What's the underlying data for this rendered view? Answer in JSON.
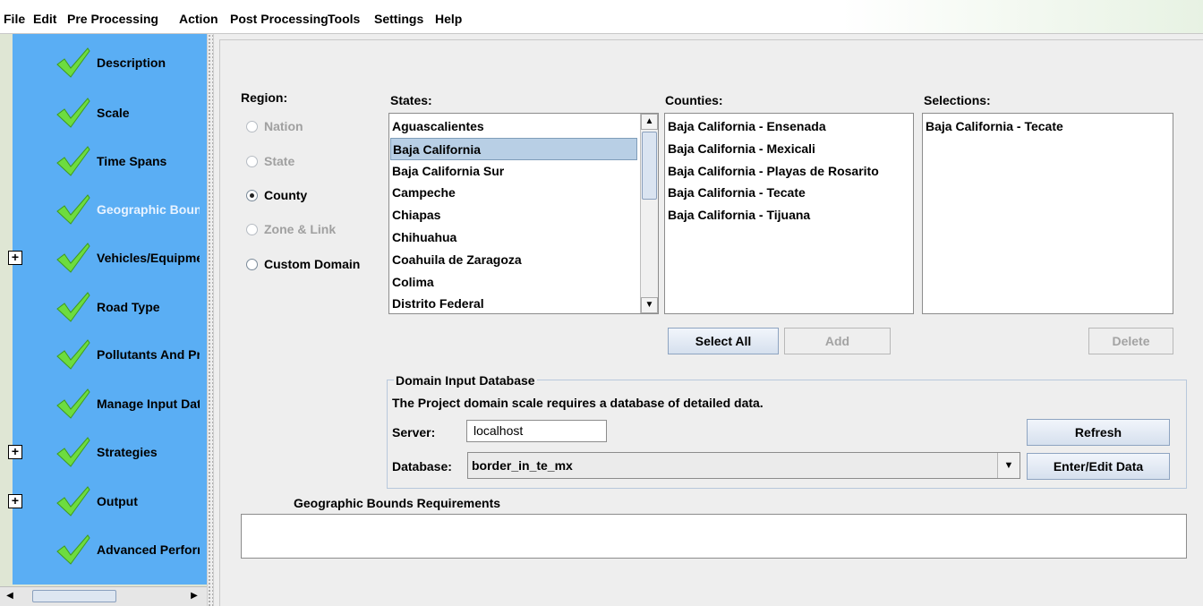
{
  "menu": [
    {
      "label": "File",
      "name": "menu-file"
    },
    {
      "label": "Edit",
      "name": "menu-edit"
    },
    {
      "label": "Pre Processing",
      "name": "menu-pre-processing"
    },
    {
      "label": "Action",
      "name": "menu-action"
    },
    {
      "label": "Post Processing",
      "name": "menu-post-processing"
    },
    {
      "label": "Tools",
      "name": "menu-tools"
    },
    {
      "label": "Settings",
      "name": "menu-settings"
    },
    {
      "label": "Help",
      "name": "menu-help"
    }
  ],
  "nav": {
    "items": [
      {
        "label": "Description",
        "expandable": false,
        "active": false
      },
      {
        "label": "Scale",
        "expandable": false,
        "active": false
      },
      {
        "label": "Time Spans",
        "expandable": false,
        "active": false
      },
      {
        "label": "Geographic Bounds",
        "expandable": false,
        "active": true
      },
      {
        "label": "Vehicles/Equipment",
        "expandable": true,
        "active": false
      },
      {
        "label": "Road Type",
        "expandable": false,
        "active": false
      },
      {
        "label": "Pollutants And Processes",
        "expandable": false,
        "active": false
      },
      {
        "label": "Manage Input Data Sets",
        "expandable": false,
        "active": false
      },
      {
        "label": "Strategies",
        "expandable": true,
        "active": false
      },
      {
        "label": "Output",
        "expandable": true,
        "active": false
      },
      {
        "label": "Advanced Performance Features",
        "expandable": false,
        "active": false
      }
    ],
    "expand_glyph": "+",
    "check_color": "#6ddc3f"
  },
  "region": {
    "label": "Region:",
    "options": [
      {
        "label": "Nation",
        "selected": false,
        "disabled": true
      },
      {
        "label": "State",
        "selected": false,
        "disabled": true
      },
      {
        "label": "County",
        "selected": true,
        "disabled": false
      },
      {
        "label": "Zone & Link",
        "selected": false,
        "disabled": true
      },
      {
        "label": "Custom Domain",
        "selected": false,
        "disabled": false
      }
    ]
  },
  "states": {
    "label": "States:",
    "items": [
      "Aguascalientes",
      "Baja California",
      "Baja California Sur",
      "Campeche",
      "Chiapas",
      "Chihuahua",
      "Coahuila de Zaragoza",
      "Colima",
      "Distrito Federal"
    ],
    "selected_index": 1
  },
  "counties": {
    "label": "Counties:",
    "items": [
      "Baja California - Ensenada",
      "Baja California - Mexicali",
      "Baja California - Playas de Rosarito",
      "Baja California - Tecate",
      "Baja California - Tijuana"
    ]
  },
  "selections": {
    "label": "Selections:",
    "items": [
      "Baja California - Tecate"
    ]
  },
  "buttons": {
    "select_all": "Select All",
    "add": "Add",
    "delete": "Delete",
    "refresh": "Refresh",
    "enter_edit": "Enter/Edit Data"
  },
  "domain_db": {
    "title": "Domain Input Database",
    "description": "The Project domain scale requires a database of detailed data.",
    "server_label": "Server:",
    "server_value": "localhost",
    "database_label": "Database:",
    "database_value": "border_in_te_mx"
  },
  "requirements": {
    "title": "Geographic Bounds Requirements",
    "text": ""
  },
  "icons": {
    "check": "checkmark-icon",
    "scroll_up": "▲",
    "scroll_down": "▼",
    "scroll_left": "◀",
    "scroll_right": "▶",
    "combo_arrow": "▼"
  }
}
